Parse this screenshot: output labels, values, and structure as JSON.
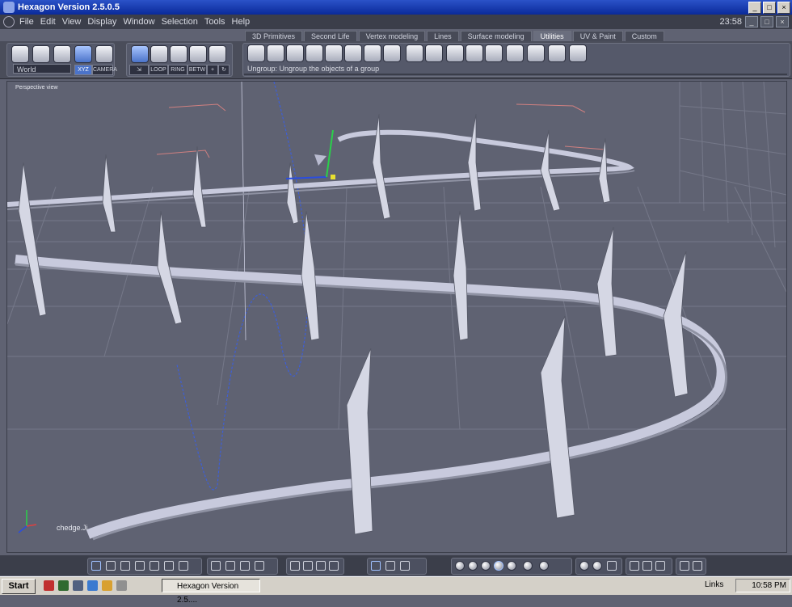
{
  "window": {
    "title": "Hexagon Version 2.5.0.5"
  },
  "menu": {
    "items": [
      "File",
      "Edit",
      "View",
      "Display",
      "Window",
      "Selection",
      "Tools",
      "Help"
    ],
    "clock": "23:58"
  },
  "tabs": [
    "3D Primitives",
    "Second Life",
    "Vertex modeling",
    "Lines",
    "Surface modeling",
    "Utilities",
    "UV & Paint",
    "Custom"
  ],
  "active_tab": "Utilities",
  "toolbar": {
    "coordinate_space": "World",
    "xyz_label": "XYZ",
    "camera_label": "CAMERA",
    "loop_label": "LOOP",
    "ring_label": "RING",
    "betw_label": "BETW",
    "hint": "Ungroup: Ungroup the objects of a group"
  },
  "viewport": {
    "label": "Perspective view",
    "object_label": "chedge.Ji"
  },
  "taskbar": {
    "start": "Start",
    "task": "Hexagon Version 2.5....",
    "links": "Links",
    "tray_time": "10:58 PM"
  },
  "colors": {
    "titlebar": "#0a2a9a",
    "background": "#5f6272",
    "structure": "#c8cadd",
    "accent": "#4b73c9"
  }
}
